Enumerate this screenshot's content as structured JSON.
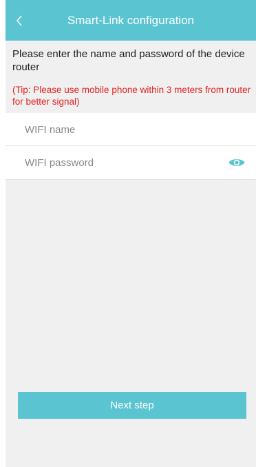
{
  "header": {
    "title": "Smart-Link configuration",
    "back_icon": "chevron-left-icon"
  },
  "intro": {
    "instruction": "Please enter the name and password of the device router",
    "tip": "(Tip: Please use mobile phone within 3 meters from router for better signal)"
  },
  "form": {
    "wifi_name": {
      "placeholder": "WIFI name",
      "value": ""
    },
    "wifi_password": {
      "placeholder": "WIFI password",
      "value": "",
      "toggle_icon": "eye-icon"
    }
  },
  "actions": {
    "next_label": "Next step"
  },
  "colors": {
    "accent": "#5bc4d1",
    "tip": "#e62222",
    "background": "#f0f0f0"
  }
}
